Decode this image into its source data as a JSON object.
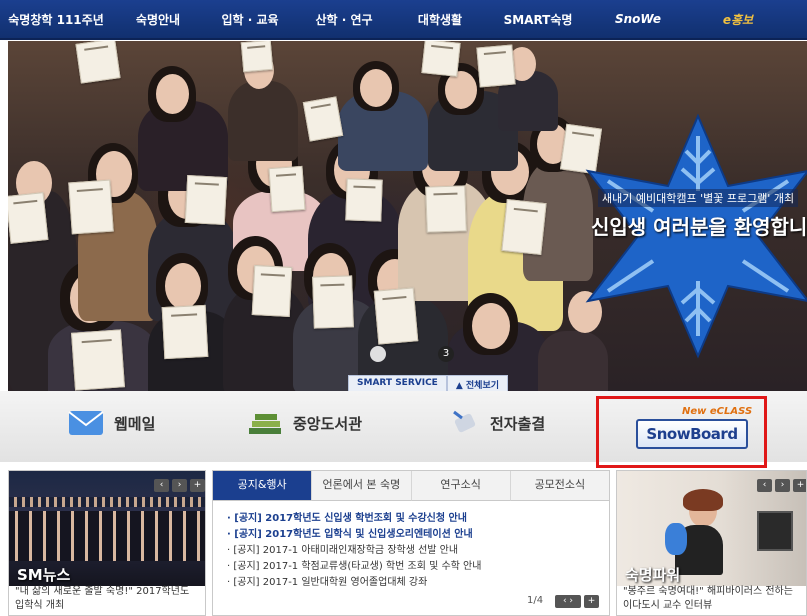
{
  "nav": {
    "items": [
      "숙명창학 111주년",
      "숙명안내",
      "입학 · 교육",
      "산학 · 연구",
      "대학생활",
      "SMART숙명",
      "SnoWe",
      "e홍보"
    ]
  },
  "hero": {
    "welcome_small": "새내기 예비대학캠프 '별꽃 프로그램' 개최",
    "welcome_big": "신입생 여러분을 환영합니다!",
    "slide_number": "3",
    "smart_service": "SMART SERVICE",
    "view_all": "▲ 전체보기"
  },
  "quick": {
    "webmail": "웹메일",
    "library": "중앙도서관",
    "attendance": "전자출결",
    "new_eclass": "New eCLASS",
    "snowboard": "SnowBoard"
  },
  "sm_news": {
    "title": "SM뉴스",
    "caption": "\"내 삶의 새로운 출발 숙명!\" 2017학년도 입학식 개최"
  },
  "notice": {
    "tabs": [
      "공지&행사",
      "언론에서 본 숙명",
      "연구소식",
      "공모전소식"
    ],
    "items": [
      {
        "text": "· [공지] 2017학년도 신입생 학번조회 및 수강신청 안내",
        "strong": true
      },
      {
        "text": "· [공지] 2017학년도 입학식 및 신입생오리엔테이션 안내",
        "strong": true
      },
      {
        "text": "· [공지] 2017-1 아태미래인재장학금 장학생 선발 안내",
        "strong": false
      },
      {
        "text": "· [공지] 2017-1 학점교류생(타교생) 학번 조회 및 수학 안내",
        "strong": false
      },
      {
        "text": "· [공지] 2017-1 일반대학원 영어졸업대체 강좌",
        "strong": false
      }
    ],
    "page": "1/4"
  },
  "power": {
    "title": "숙명파워",
    "caption": "\"봉주르 숙명여대!\" 해피바이러스 전하는 이다도시 교수 인터뷰"
  },
  "colors": {
    "navy": "#1b3f8f",
    "red": "#e01717"
  }
}
